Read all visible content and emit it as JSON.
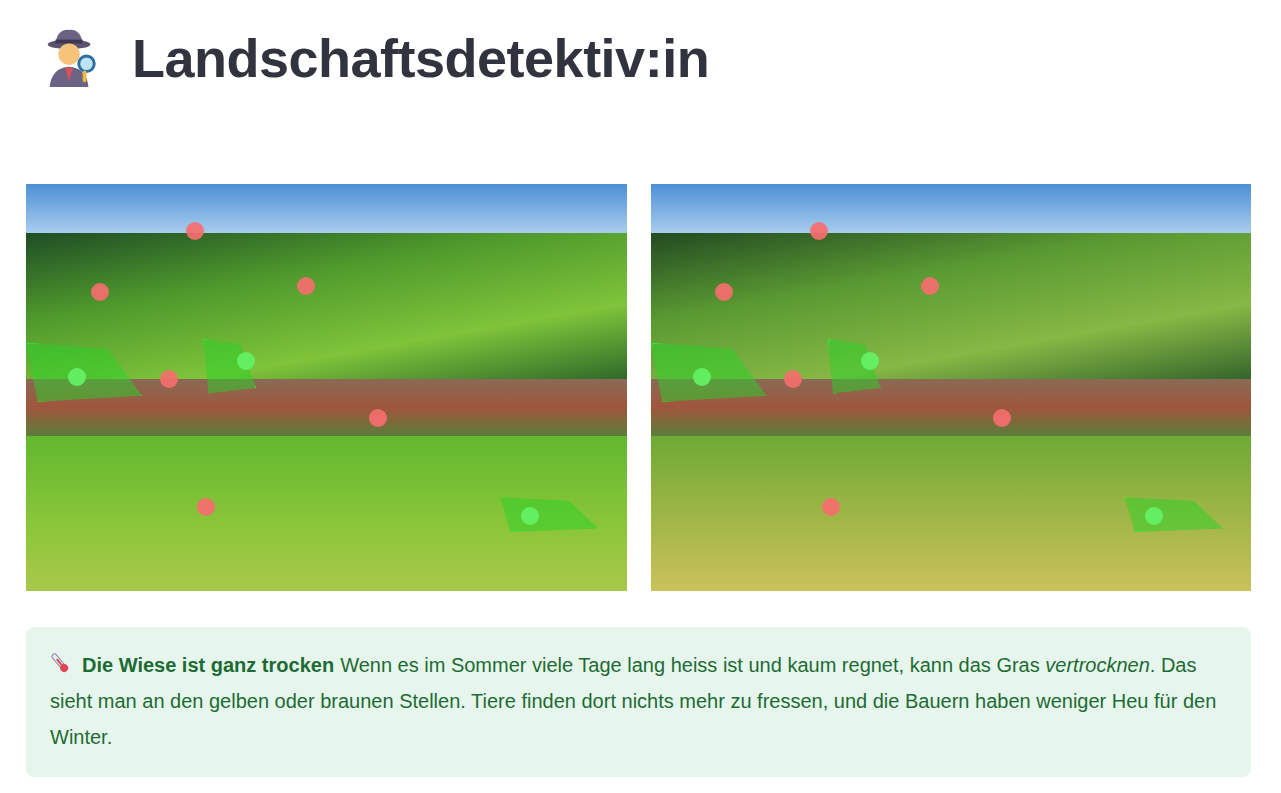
{
  "page": {
    "title": "Landschaftsdetektiv:in"
  },
  "scenes": [
    {
      "markers": [
        {
          "found": false
        },
        {
          "found": false
        },
        {
          "found": false
        },
        {
          "found": false
        },
        {
          "found": false
        },
        {
          "found": false
        },
        {
          "found": true
        },
        {
          "found": true
        },
        {
          "found": true
        }
      ]
    },
    {
      "markers": [
        {
          "found": false
        },
        {
          "found": false
        },
        {
          "found": false
        },
        {
          "found": false
        },
        {
          "found": false
        },
        {
          "found": false
        },
        {
          "found": true
        },
        {
          "found": true
        },
        {
          "found": true
        }
      ]
    }
  ],
  "info": {
    "title": "Die Wiese ist ganz trocken",
    "segments": [
      {
        "text": "Wenn es im Sommer viele Tage lang heiss ist und kaum regnet, kann das Gras ",
        "emphasis": false
      },
      {
        "text": "vertrocknen",
        "emphasis": true
      },
      {
        "text": ". Das sieht man an den gelben oder braunen Stellen. Tiere finden dort nichts mehr zu fressen, und die Bauern haben weniger Heu für den Winter.",
        "emphasis": false
      }
    ]
  }
}
